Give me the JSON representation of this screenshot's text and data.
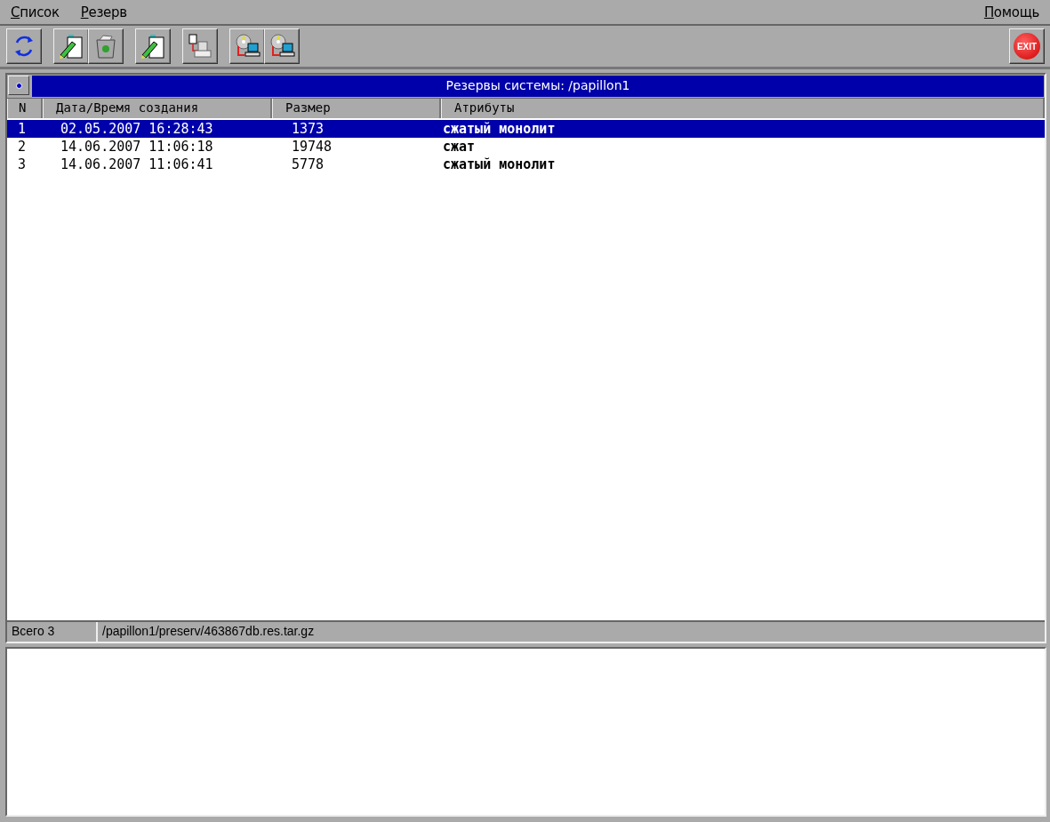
{
  "menu": [
    {
      "label": "Список"
    },
    {
      "label": "Резерв"
    }
  ],
  "help_menu": {
    "label": "Помощь"
  },
  "toolbar": [
    {
      "kind": "refresh"
    },
    {
      "kind": "edit"
    },
    {
      "kind": "trash"
    },
    {
      "kind": "edit"
    },
    {
      "kind": "print"
    },
    {
      "kind": "restore"
    },
    {
      "kind": "restore"
    }
  ],
  "exit_button": {
    "label": "EXIT"
  },
  "panel": {
    "title": "Резервы системы: /papillon1"
  },
  "table": {
    "columns": [
      "N",
      "Дата/Время создания",
      "Размер",
      "Атрибуты"
    ],
    "rows": [
      {
        "cells": [
          "1",
          "02.05.2007 16:28:43",
          "1373",
          "сжатый монолит"
        ],
        "selected": true
      },
      {
        "cells": [
          "2",
          "14.06.2007 11:06:18",
          "19748",
          "сжат"
        ],
        "selected": false
      },
      {
        "cells": [
          "3",
          "14.06.2007 11:06:41",
          "5778",
          "сжатый монолит"
        ],
        "selected": false
      }
    ]
  },
  "status_bar": {
    "count": "Всего 3",
    "path": "/papillon1/preserv/463867db.res.tar.gz"
  }
}
